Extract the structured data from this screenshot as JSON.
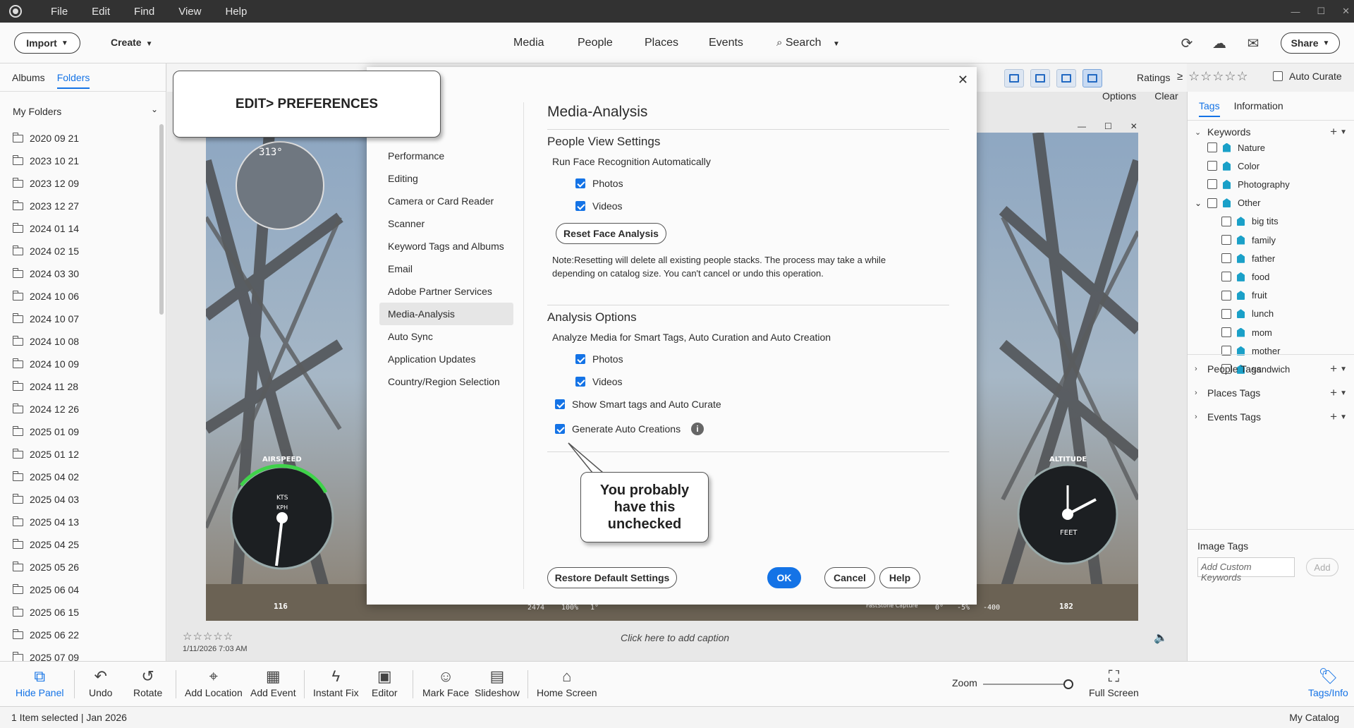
{
  "menubar": {
    "items": [
      "File",
      "Edit",
      "Find",
      "View",
      "Help"
    ]
  },
  "topbar": {
    "import_label": "Import",
    "create_label": "Create",
    "nav": [
      "Media",
      "People",
      "Places",
      "Events"
    ],
    "search_label": "Search",
    "share_label": "Share"
  },
  "left_panel": {
    "tabs": [
      "Albums",
      "Folders"
    ],
    "section_title": "My Folders",
    "folders": [
      "2020 09 21",
      "2023 10 21",
      "2023 12 09",
      "2023 12 27",
      "2024 01 14",
      "2024 02 15",
      "2024 03 30",
      "2024 10 06",
      "2024 10 07",
      "2024 10 08",
      "2024 10 09",
      "2024 11 28",
      "2024 12 26",
      "2025 01 09",
      "2025 01 12",
      "2025 04 02",
      "2025 04 03",
      "2025 04 13",
      "2025 04 25",
      "2025 05 26",
      "2025 06 04",
      "2025 06 15",
      "2025 06 22",
      "2025 07 09"
    ]
  },
  "view_toolbar": {
    "ratings_label": "Ratings",
    "ratings_operator": "≥",
    "ratings_stars": "☆☆☆☆☆",
    "auto_curate_label": "Auto Curate",
    "options_label": "Options",
    "clear_label": "Clear"
  },
  "photo": {
    "rating_stars": "☆☆☆☆☆",
    "date": "1/11/2026 7:03 AM",
    "caption_placeholder": "Click here to add caption",
    "hud": {
      "heading": "313°",
      "airspeed_label": "AIRSPEED",
      "airspeed_value": "116",
      "altitude_label": "ALTITUDE",
      "altitude_value": "182",
      "feet_label": "FEET",
      "kts_label": "KTS",
      "kph_label": "KPH",
      "bottom_values": [
        "2474",
        "100%",
        "1°",
        "0°",
        "-5%",
        "-400"
      ],
      "capture_label": "FastStone Capture"
    }
  },
  "dialog": {
    "nav_items": [
      "Performance",
      "Editing",
      "Camera or Card Reader",
      "Scanner",
      "Keyword Tags and Albums",
      "Email",
      "Adobe Partner Services",
      "Media-Analysis",
      "Auto Sync",
      "Application Updates",
      "Country/Region Selection"
    ],
    "active_item": "Media-Analysis",
    "title": "Media-Analysis",
    "people_section": "People View Settings",
    "face_recognition_label": "Run Face Recognition Automatically",
    "photos_label": "Photos",
    "videos_label": "Videos",
    "reset_face_button": "Reset Face Analysis",
    "note_line1": "Note:Resetting will delete all existing people stacks. The process may take a while",
    "note_line2": "depending on catalog size. You can't cancel or undo this operation.",
    "analysis_section": "Analysis Options",
    "analyze_label": "Analyze Media for Smart Tags, Auto Curation and Auto Creation",
    "smart_tags_label": "Show Smart tags and Auto Curate",
    "auto_creations_label": "Generate Auto Creations",
    "restore_button": "Restore Default Settings",
    "ok_button": "OK",
    "cancel_button": "Cancel",
    "help_button": "Help",
    "close_glyph": "✕",
    "info_glyph": "i"
  },
  "callouts": {
    "edit_preferences": "EDIT> PREFERENCES",
    "unchecked_note": "You probably have this unchecked"
  },
  "right_panel": {
    "tabs": [
      "Tags",
      "Information"
    ],
    "keywords_label": "Keywords",
    "keywords": [
      "Nature",
      "Color",
      "Photography",
      "Other"
    ],
    "other_children": [
      "big tits",
      "family",
      "father",
      "food",
      "fruit",
      "lunch",
      "mom",
      "mother",
      "sandwich"
    ],
    "people_tags": "People Tags",
    "places_tags": "Places Tags",
    "events_tags": "Events Tags",
    "image_tags_label": "Image Tags",
    "custom_keywords_placeholder": "Add Custom Keywords",
    "add_button": "Add"
  },
  "taskbar": {
    "hide_panel": "Hide Panel",
    "undo": "Undo",
    "rotate": "Rotate",
    "add_location": "Add Location",
    "add_event": "Add Event",
    "instant_fix": "Instant Fix",
    "editor": "Editor",
    "mark_face": "Mark Face",
    "slideshow": "Slideshow",
    "home_screen": "Home Screen",
    "zoom": "Zoom",
    "full_screen": "Full Screen",
    "tags_info": "Tags/Info"
  },
  "statusbar": {
    "selection": "1 Item selected | Jan 2026",
    "catalog": "My Catalog"
  },
  "colors": {
    "accent": "#1473e6",
    "titlebar": "#323232",
    "tag": "#1aa0c8"
  }
}
